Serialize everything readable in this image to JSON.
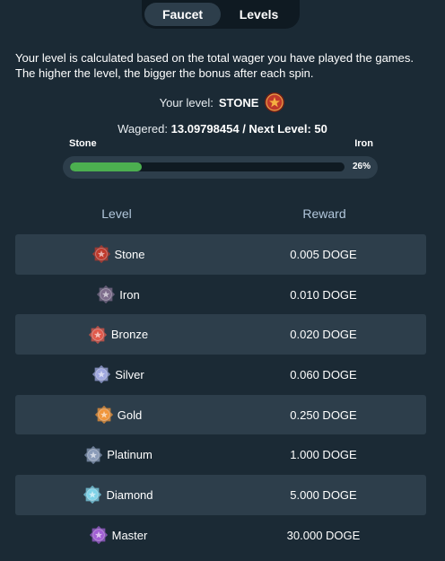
{
  "tabs": [
    {
      "label": "Faucet",
      "active": true
    },
    {
      "label": "Levels",
      "active": false
    }
  ],
  "description": {
    "line1": "Your level is calculated based on the total wager you have played the games.",
    "line2": "The higher the level, the bigger the bonus after each spin."
  },
  "current": {
    "label": "Your level:",
    "level": "STONE",
    "badge_icon": "stone-badge-icon",
    "wagered_label": "Wagered:",
    "wagered_value": "13.09798454",
    "next_label": "/ Next Level:",
    "next_value": "50"
  },
  "progress": {
    "from": "Stone",
    "to": "Iron",
    "percent_text": "26%",
    "fraction": 0.26,
    "fill_color": "#4caf50"
  },
  "table": {
    "headers": {
      "level": "Level",
      "reward": "Reward"
    },
    "rows": [
      {
        "level": "Stone",
        "reward": "0.005 DOGE",
        "icon": "stone-badge-icon",
        "color": "#c0392b"
      },
      {
        "level": "Iron",
        "reward": "0.010 DOGE",
        "icon": "iron-badge-icon",
        "color": "#7e6d8c"
      },
      {
        "level": "Bronze",
        "reward": "0.020 DOGE",
        "icon": "bronze-badge-icon",
        "color": "#e0584a"
      },
      {
        "level": "Silver",
        "reward": "0.060 DOGE",
        "icon": "silver-badge-icon",
        "color": "#9fa8e0"
      },
      {
        "level": "Gold",
        "reward": "0.250 DOGE",
        "icon": "gold-badge-icon",
        "color": "#f0953a"
      },
      {
        "level": "Platinum",
        "reward": "1.000 DOGE",
        "icon": "platinum-badge-icon",
        "color": "#8a9bb8"
      },
      {
        "level": "Diamond",
        "reward": "5.000 DOGE",
        "icon": "diamond-badge-icon",
        "color": "#7fd3e8"
      },
      {
        "level": "Master",
        "reward": "30.000 DOGE",
        "icon": "master-badge-icon",
        "color": "#a25fd4"
      }
    ]
  },
  "colors": {
    "background": "#1b2a35",
    "row_shade": "#2d3e4b",
    "header_text": "#b2c7dc"
  }
}
